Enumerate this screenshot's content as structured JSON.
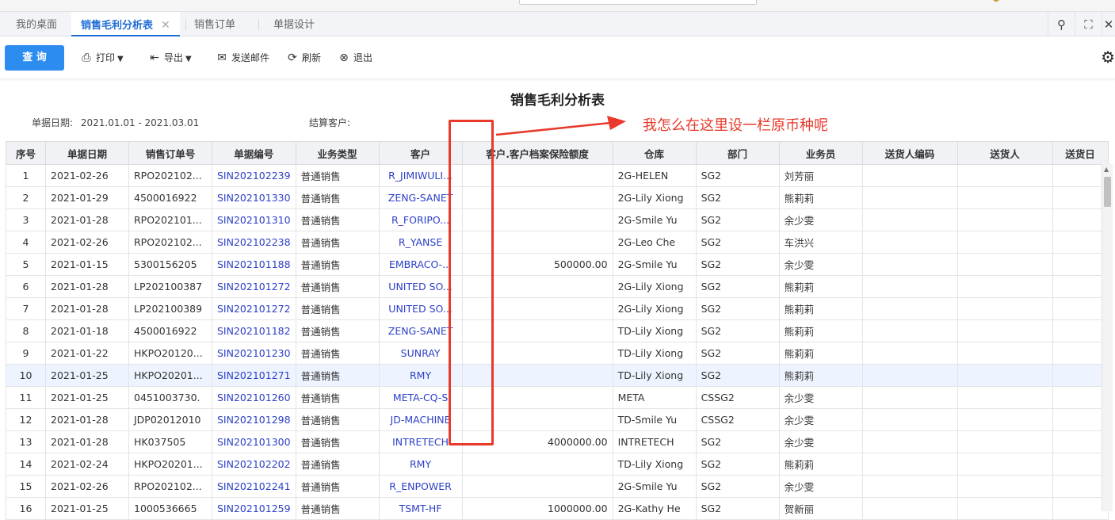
{
  "tabs": [
    {
      "label": "我的桌面",
      "active": false
    },
    {
      "label": "销售毛利分析表",
      "active": true,
      "closable": true
    },
    {
      "label": "销售订单",
      "active": false
    },
    {
      "label": "单据设计",
      "active": false
    }
  ],
  "tab_tools": [
    "search-icon",
    "fullscreen-icon",
    "close-icon"
  ],
  "toolbar": {
    "query_label": "查 询",
    "print_label": "打印",
    "export_label": "导出",
    "email_label": "发送邮件",
    "refresh_label": "刷新",
    "exit_label": "退出"
  },
  "report": {
    "title": "销售毛利分析表",
    "date_label": "单据日期:",
    "date_range": "2021.01.01 - 2021.03.01",
    "customer_label": "结算客户:"
  },
  "annotation": {
    "text": "我怎么在这里设一栏原币种呢",
    "color": "#e8392a"
  },
  "table": {
    "columns": [
      "序号",
      "单据日期",
      "销售订单号",
      "单据编号",
      "业务类型",
      "客户",
      "客户.客户档案保险额度",
      "仓库",
      "部门",
      "业务员",
      "送货人编码",
      "送货人",
      "送货日"
    ],
    "rows": [
      [
        "1",
        "2021-02-26",
        "RPO202102...",
        "SIN202102239",
        "普通销售",
        "R_JIMIWULI...",
        "",
        "2G-HELEN",
        "SG2",
        "刘芳丽",
        "",
        "",
        ""
      ],
      [
        "2",
        "2021-01-29",
        "4500016922",
        "SIN202101330",
        "普通销售",
        "ZENG-SANET",
        "",
        "2G-Lily Xiong",
        "SG2",
        "熊莉莉",
        "",
        "",
        ""
      ],
      [
        "3",
        "2021-01-28",
        "RPO202101...",
        "SIN202101310",
        "普通销售",
        "R_FORIPO...",
        "",
        "2G-Smile Yu",
        "SG2",
        "余少雯",
        "",
        "",
        ""
      ],
      [
        "4",
        "2021-02-26",
        "RPO202102...",
        "SIN202102238",
        "普通销售",
        "R_YANSE",
        "",
        "2G-Leo Che",
        "SG2",
        "车洪兴",
        "",
        "",
        ""
      ],
      [
        "5",
        "2021-01-15",
        "5300156205",
        "SIN202101188",
        "普通销售",
        "EMBRACO-...",
        "500000.00",
        "2G-Smile Yu",
        "SG2",
        "余少雯",
        "",
        "",
        ""
      ],
      [
        "6",
        "2021-01-28",
        "LP202100387",
        "SIN202101272",
        "普通销售",
        "UNITED SO...",
        "",
        "2G-Lily Xiong",
        "SG2",
        "熊莉莉",
        "",
        "",
        ""
      ],
      [
        "7",
        "2021-01-28",
        "LP202100389",
        "SIN202101272",
        "普通销售",
        "UNITED SO...",
        "",
        "2G-Lily Xiong",
        "SG2",
        "熊莉莉",
        "",
        "",
        ""
      ],
      [
        "8",
        "2021-01-18",
        "4500016922",
        "SIN202101182",
        "普通销售",
        "ZENG-SANET",
        "",
        "TD-Lily Xiong",
        "SG2",
        "熊莉莉",
        "",
        "",
        ""
      ],
      [
        "9",
        "2021-01-22",
        "HKPO20120...",
        "SIN202101230",
        "普通销售",
        "SUNRAY",
        "",
        "TD-Lily Xiong",
        "SG2",
        "熊莉莉",
        "",
        "",
        ""
      ],
      [
        "10",
        "2021-01-25",
        "HKPO20201...",
        "SIN202101271",
        "普通销售",
        "RMY",
        "",
        "TD-Lily Xiong",
        "SG2",
        "熊莉莉",
        "",
        "",
        ""
      ],
      [
        "11",
        "2021-01-25",
        "0451003730.",
        "SIN202101260",
        "普通销售",
        "META-CQ-S",
        "",
        "META",
        "CSSG2",
        "余少雯",
        "",
        "",
        ""
      ],
      [
        "12",
        "2021-01-28",
        "JDP02012010",
        "SIN202101298",
        "普通销售",
        "JD-MACHINE",
        "",
        "TD-Smile Yu",
        "CSSG2",
        "余少雯",
        "",
        "",
        ""
      ],
      [
        "13",
        "2021-01-28",
        "HK037505",
        "SIN202101300",
        "普通销售",
        "INTRETECH",
        "4000000.00",
        "INTRETECH",
        "SG2",
        "余少雯",
        "",
        "",
        ""
      ],
      [
        "14",
        "2021-02-24",
        "HKPO20201...",
        "SIN202102202",
        "普通销售",
        "RMY",
        "",
        "TD-Lily Xiong",
        "SG2",
        "熊莉莉",
        "",
        "",
        ""
      ],
      [
        "15",
        "2021-02-26",
        "RPO202102...",
        "SIN202102241",
        "普通销售",
        "R_ENPOWER",
        "",
        "2G-Smile Yu",
        "SG2",
        "余少雯",
        "",
        "",
        ""
      ],
      [
        "16",
        "2021-01-25",
        "1000536665",
        "SIN202101259",
        "普通销售",
        "TSMT-HF",
        "1000000.00",
        "2G-Kathy He",
        "SG2",
        "贺新丽",
        "",
        "",
        ""
      ]
    ],
    "highlighted_row": 10
  },
  "colors": {
    "accent": "#2d8cf0",
    "tab_active": "#1f6dd6",
    "link": "#2d40c8",
    "annotation_red": "#e8392a"
  }
}
